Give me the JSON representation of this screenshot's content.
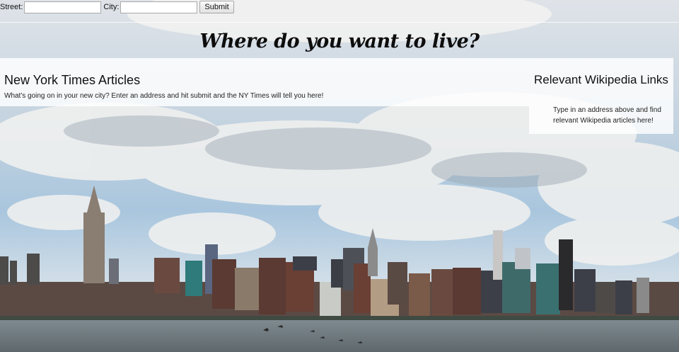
{
  "form": {
    "street_label": "Street:",
    "street_value": "",
    "city_label": "City:",
    "city_value": "",
    "submit_label": "Submit"
  },
  "headline": "Where do you want to live?",
  "nyt": {
    "title": "New York Times Articles",
    "description": "What's going on in your new city? Enter an address and hit submit and the NY Times will tell you here!"
  },
  "wiki": {
    "title": "Relevant Wikipedia Links",
    "description": "Type in an address above and find relevant Wikipedia articles here!"
  },
  "colors": {
    "sky": "#b9cfe0",
    "water": "#6f7a80",
    "panel": "#ffffff"
  }
}
